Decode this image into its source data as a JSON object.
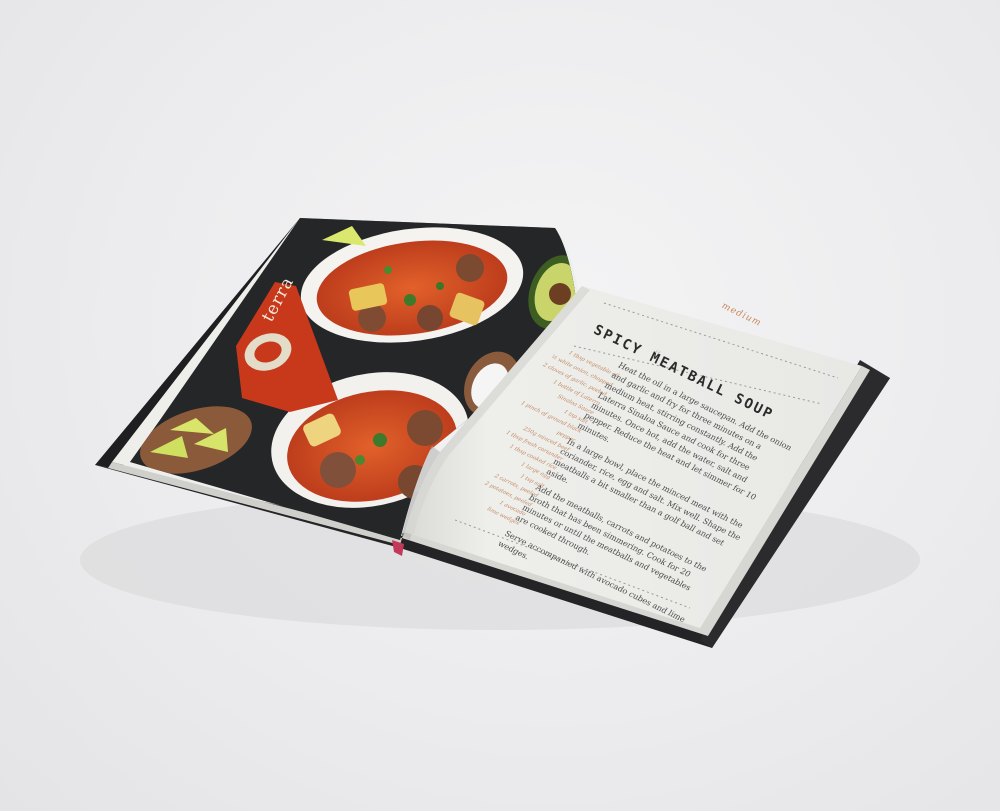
{
  "recipe": {
    "difficulty": "medium",
    "title": "SPICY MEATBALL SOUP",
    "quote_mark": "“",
    "steps": [
      "Heat the oil in a large saucepan. Add the onion and garlic and fry for three minutes on a medium heat, stirring constantly. Add the Laterra Sinaloa Sauce and cook for three minutes. Once hot, add the water, salt and pepper. Reduce the heat and let simmer for 10 minutes.",
      "In a large bowl, place the minced meat with the coriander, rice, egg and salt. Mix well. Shape the meatballs a bit smaller than a golf ball and set aside.",
      "Add the meatballs, carrots and potatoes to the broth that has been simmering. Cook for 20 minutes or until the meatballs and vegetables are cooked through.",
      "Serve accompanied with avocado cubes and lime wedges."
    ],
    "ingredients": [
      "1 tbsp vegetable oil",
      "½ white onion, chopped",
      "2 cloves of garlic, peeled",
      "1 bottle of Laterra",
      "Sinaloa Sauce",
      "1 tsp salt",
      "1 pinch of ground black",
      "pepper",
      "250g minced beef",
      "1 tbsp fresh coriander",
      "1 tbsp cooked rice",
      "1 large egg",
      "1 tsp salt",
      "2 carrots, peeled",
      "2 potatoes, peeled",
      "1 avocado",
      "lime wedges"
    ]
  },
  "photo": {
    "brand_label": "terra"
  },
  "colors": {
    "cover": "#2a2a2c",
    "page": "#ecece9",
    "soup": "#c9431a",
    "accent_orange": "#c38a62"
  }
}
